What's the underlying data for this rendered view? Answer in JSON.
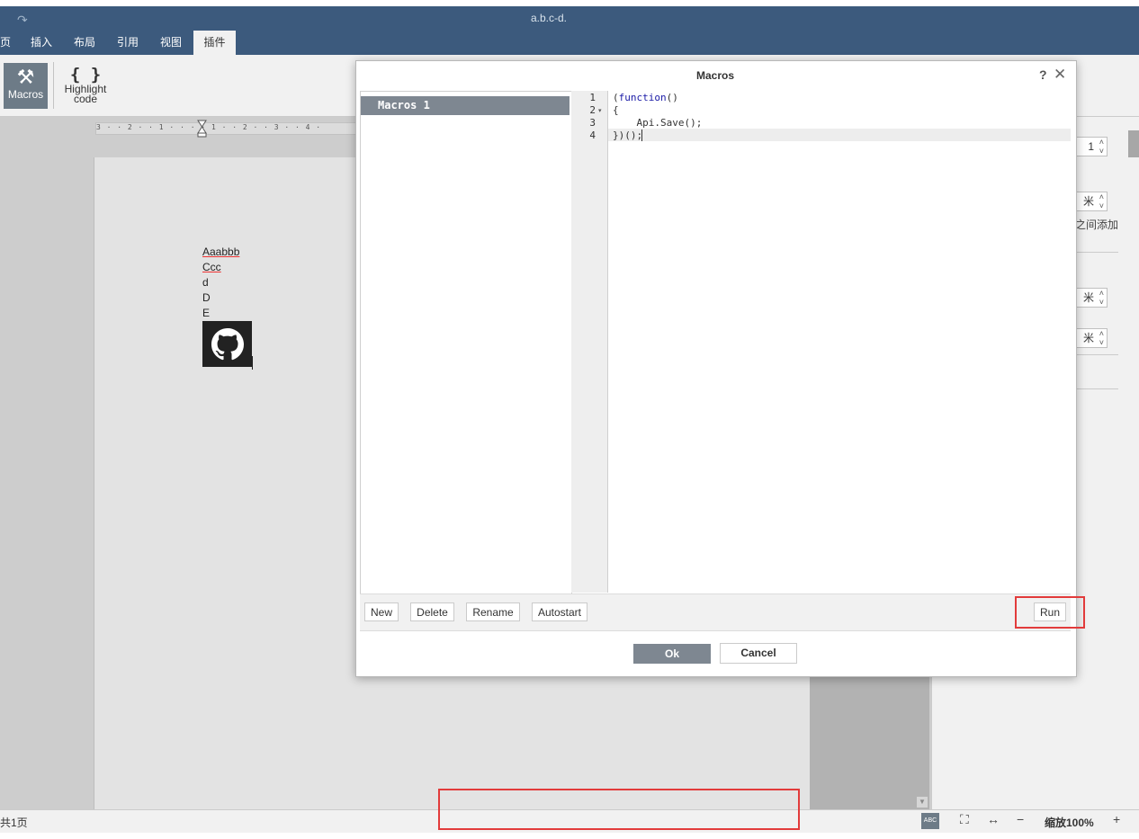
{
  "window": {
    "redo_icon": "↷",
    "title": "a.b.c-d."
  },
  "menu_tabs": [
    {
      "label": "页"
    },
    {
      "label": "插入"
    },
    {
      "label": "布局"
    },
    {
      "label": "引用"
    },
    {
      "label": "视图"
    },
    {
      "label": "插件",
      "active": true
    }
  ],
  "toolbar": {
    "macros_icon": "⚒",
    "macros_label": "Macros",
    "highlight_icon": "{ }",
    "highlight_label_1": "Highlight",
    "highlight_label_2": "code"
  },
  "ruler": {
    "text": "3 · · 2 · · 1 · ·   · · 1 · · 2 · · 3 · · 4 ·"
  },
  "document": {
    "lines": [
      "Aaabbb",
      "Ccc",
      "d",
      "D",
      "E"
    ],
    "image_icon": "github-icon"
  },
  "right_panel": {
    "spin_values": [
      "1",
      "米",
      "米",
      "米"
    ],
    "text_1": "之间添加"
  },
  "status_bar": {
    "page_count": "共1页",
    "spell_check_icon": "ABC",
    "fit_page_icon": "⛶",
    "fit_width_icon": "↔",
    "zoom_out_icon": "−",
    "zoom_label": "缩放100%",
    "zoom_in_icon": "+"
  },
  "dialog": {
    "title": "Macros",
    "help_icon": "?",
    "close_icon": "✕",
    "macros": [
      {
        "name": "Macros 1",
        "selected": true
      }
    ],
    "line_numbers": [
      "1",
      "2",
      "3",
      "4"
    ],
    "fold_marker": "▾",
    "code": {
      "line1_open": "(",
      "line1_kw": "function",
      "line1_close": "()",
      "line2": "{",
      "line3": "    Api.Save();",
      "line4": "})();"
    },
    "buttons": {
      "new": "New",
      "delete": "Delete",
      "rename": "Rename",
      "autostart": "Autostart",
      "run": "Run",
      "ok": "Ok",
      "cancel": "Cancel"
    }
  },
  "colors": {
    "title_bar": "#3c5a7d",
    "accent_gray": "#7e8791",
    "annotation_red": "#e23b3b"
  }
}
